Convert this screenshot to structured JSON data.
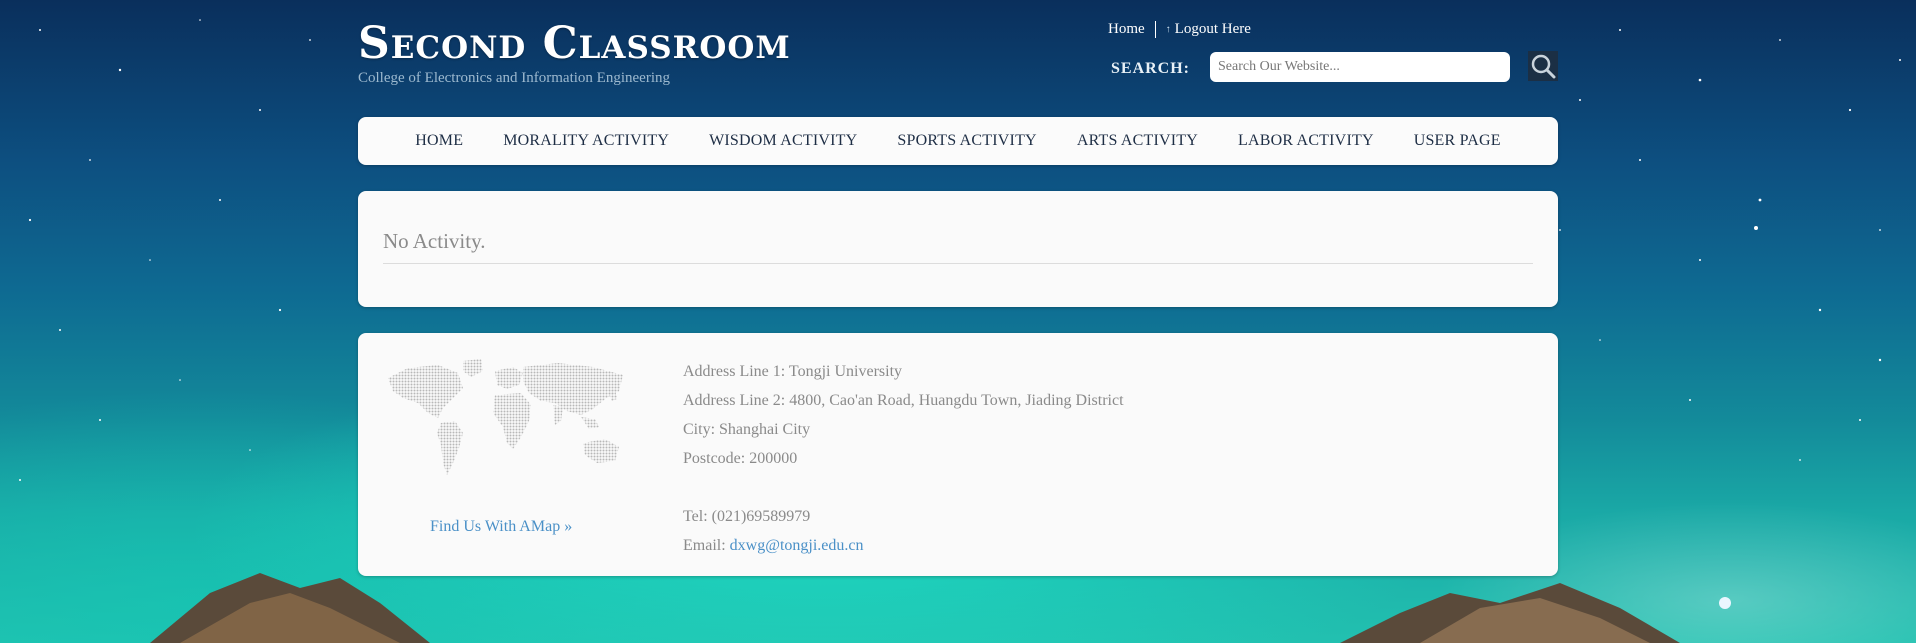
{
  "header": {
    "title": "Second Classroom",
    "subtitle": "College of Electronics and Information Engineering",
    "links": {
      "home": "Home",
      "logout": "Logout Here"
    },
    "search": {
      "label": "SEARCH:",
      "placeholder": "Search Our Website..."
    }
  },
  "nav": {
    "items": [
      {
        "label": "HOME"
      },
      {
        "label": "MORALITY ACTIVITY"
      },
      {
        "label": "WISDOM ACTIVITY"
      },
      {
        "label": "SPORTS ACTIVITY"
      },
      {
        "label": "ARTS ACTIVITY"
      },
      {
        "label": "LABOR ACTIVITY"
      },
      {
        "label": "USER PAGE"
      }
    ]
  },
  "content": {
    "message": "No Activity."
  },
  "footer": {
    "map_link": "Find Us With AMap »",
    "address_line1": "Address Line 1: Tongji University",
    "address_line2": "Address Line 2: 4800, Cao'an Road, Huangdu Town, Jiading District",
    "city": "City: Shanghai City",
    "postcode": "Postcode: 200000",
    "tel": "Tel: (021)69589979",
    "email_label": "Email: ",
    "email": "dxwg@tongji.edu.cn"
  },
  "colors": {
    "link": "#4a90c7",
    "nav_text": "#1e2e45",
    "muted_text": "#8a8a8a",
    "panel_bg": "#fafafa"
  }
}
